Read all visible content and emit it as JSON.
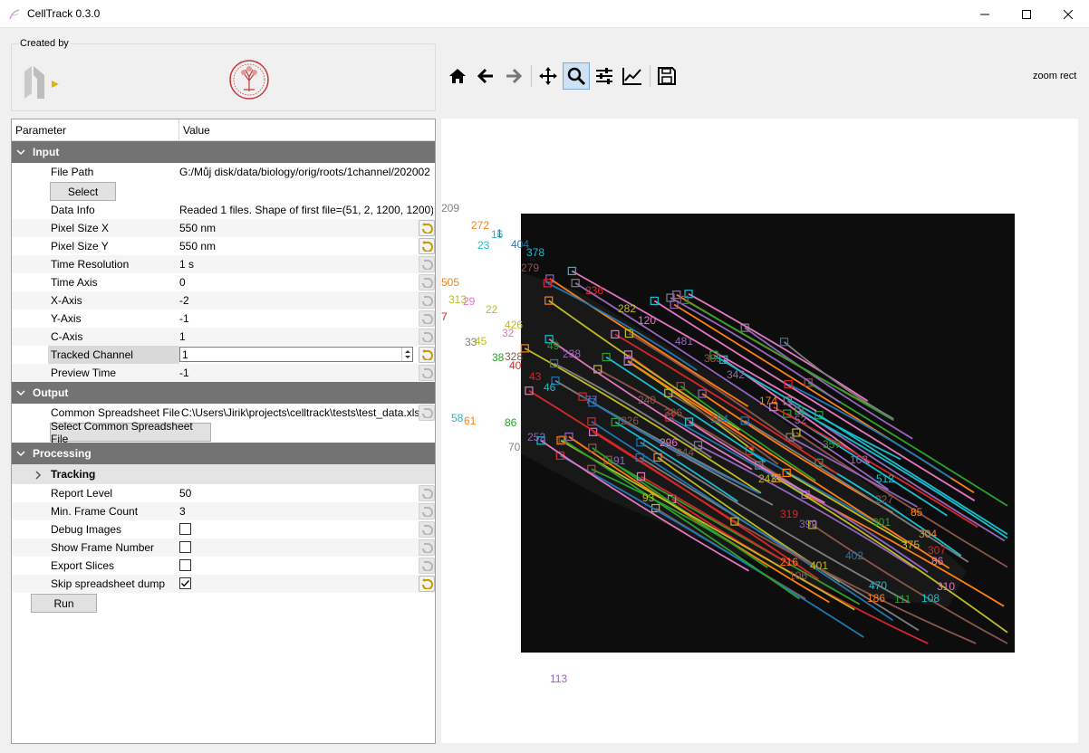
{
  "window": {
    "title": "CellTrack 0.3.0",
    "minimize_icon": "minimize-icon",
    "maximize_icon": "maximize-icon",
    "close_icon": "close-icon"
  },
  "created_by": {
    "label": "Created by"
  },
  "toolbar": {
    "buttons": [
      "home-icon",
      "back-icon",
      "forward-icon",
      "pan-icon",
      "zoom-icon",
      "configure-subplots-icon",
      "edit-axis-icon",
      "save-icon"
    ],
    "active": "zoom-icon",
    "mode_text": "zoom rect"
  },
  "tree": {
    "header": {
      "param": "Parameter",
      "value": "Value"
    },
    "input": {
      "title": "Input",
      "file_path_label": "File Path",
      "file_path_value": "G:/Můj disk/data/biology/orig/roots/1channel/202002",
      "select_button": "Select",
      "data_info_label": "Data Info",
      "data_info_value": "Readed 1 files. Shape of first file=(51, 2, 1200, 1200)",
      "pixel_x_label": "Pixel Size X",
      "pixel_x_value": "550 nm",
      "pixel_y_label": "Pixel Size Y",
      "pixel_y_value": "550 nm",
      "time_res_label": "Time Resolution",
      "time_res_value": "1 s",
      "time_axis_label": "Time Axis",
      "time_axis_value": "0",
      "x_axis_label": "X-Axis",
      "x_axis_value": "-2",
      "y_axis_label": "Y-Axis",
      "y_axis_value": "-1",
      "c_axis_label": "C-Axis",
      "c_axis_value": "1",
      "tracked_channel_label": "Tracked Channel",
      "tracked_channel_value": "1",
      "preview_time_label": "Preview Time",
      "preview_time_value": "-1"
    },
    "output": {
      "title": "Output",
      "spreadsheet_label": "Common Spreadsheet File",
      "spreadsheet_value": "C:\\Users\\Jirik\\projects\\celltrack\\tests\\test_data.xlsx",
      "select_spreadsheet_button": "Select Common Spreadsheet File"
    },
    "processing": {
      "title": "Processing",
      "tracking_label": "Tracking",
      "report_level_label": "Report Level",
      "report_level_value": "50",
      "min_frame_label": "Min. Frame Count",
      "min_frame_value": "3",
      "debug_images_label": "Debug Images",
      "debug_images_checked": false,
      "show_frame_label": "Show Frame Number",
      "show_frame_checked": false,
      "export_slices_label": "Export Slices",
      "export_slices_checked": false,
      "skip_dump_label": "Skip spreadsheet dump",
      "skip_dump_checked": true,
      "run_button": "Run"
    }
  },
  "plot": {
    "outside_labels": [
      {
        "text": "209",
        "color": "#7f7f7f"
      },
      {
        "text": "272",
        "color": "#ff7f0e"
      },
      {
        "text": "1",
        "color": "#1f77b4"
      },
      {
        "text": "16",
        "color": "#17becf"
      },
      {
        "text": "23",
        "color": "#17becf"
      },
      {
        "text": "505",
        "color": "#ff7f0e"
      },
      {
        "text": "313",
        "color": "#bcbd22"
      },
      {
        "text": "29",
        "color": "#e377c2"
      },
      {
        "text": "7",
        "color": "#d62728"
      },
      {
        "text": "22",
        "color": "#bcbd22"
      },
      {
        "text": "33",
        "color": "#7f7f7f"
      },
      {
        "text": "45",
        "color": "#bcbd22"
      },
      {
        "text": "58",
        "color": "#17becf"
      },
      {
        "text": "61",
        "color": "#ff7f0e"
      },
      {
        "text": "113",
        "color": "#9467bd"
      }
    ],
    "track_labels": [
      {
        "text": "404",
        "color": "#1f77b4"
      },
      {
        "text": "378",
        "color": "#17becf"
      },
      {
        "text": "279",
        "color": "#8c564b"
      },
      {
        "text": "236",
        "color": "#d62728"
      },
      {
        "text": "282",
        "color": "#bcbd22"
      },
      {
        "text": "120",
        "color": "#e377c2"
      },
      {
        "text": "481",
        "color": "#9467bd"
      },
      {
        "text": "426",
        "color": "#bcbd22"
      },
      {
        "text": "32",
        "color": "#e377c2"
      },
      {
        "text": "49",
        "color": "#2ca02c"
      },
      {
        "text": "238",
        "color": "#9467bd"
      },
      {
        "text": "38",
        "color": "#2ca02c"
      },
      {
        "text": "328",
        "color": "#8c564b"
      },
      {
        "text": "40",
        "color": "#d62728"
      },
      {
        "text": "385",
        "color": "#8c564b"
      },
      {
        "text": "342",
        "color": "#9467bd"
      },
      {
        "text": "43",
        "color": "#d62728"
      },
      {
        "text": "46",
        "color": "#17becf"
      },
      {
        "text": "77",
        "color": "#9467bd"
      },
      {
        "text": "240",
        "color": "#8c564b"
      },
      {
        "text": "174",
        "color": "#ff7f0e"
      },
      {
        "text": "52",
        "color": "#9467bd"
      },
      {
        "text": "86",
        "color": "#2ca02c"
      },
      {
        "text": "226",
        "color": "#8c564b"
      },
      {
        "text": "386",
        "color": "#8c564b"
      },
      {
        "text": "164",
        "color": "#1f77b4"
      },
      {
        "text": "70",
        "color": "#7f7f7f"
      },
      {
        "text": "252",
        "color": "#9467bd"
      },
      {
        "text": "296",
        "color": "#e377c2"
      },
      {
        "text": "344",
        "color": "#8c564b"
      },
      {
        "text": "357",
        "color": "#2ca02c"
      },
      {
        "text": "163",
        "color": "#9467bd"
      },
      {
        "text": "91",
        "color": "#9467bd"
      },
      {
        "text": "243",
        "color": "#bcbd22"
      },
      {
        "text": "512",
        "color": "#17becf"
      },
      {
        "text": "227",
        "color": "#8c564b"
      },
      {
        "text": "93",
        "color": "#bcbd22"
      },
      {
        "text": "85",
        "color": "#ff7f0e"
      },
      {
        "text": "319",
        "color": "#d62728"
      },
      {
        "text": "399",
        "color": "#9467bd"
      },
      {
        "text": "301",
        "color": "#2ca02c"
      },
      {
        "text": "304",
        "color": "#ff7f0e"
      },
      {
        "text": "375",
        "color": "#bcbd22"
      },
      {
        "text": "307",
        "color": "#d62728"
      },
      {
        "text": "402",
        "color": "#1f77b4"
      },
      {
        "text": "216",
        "color": "#ff7f0e"
      },
      {
        "text": "401",
        "color": "#bcbd22"
      },
      {
        "text": "106",
        "color": "#8c564b"
      },
      {
        "text": "470",
        "color": "#17becf"
      },
      {
        "text": "186",
        "color": "#ff7f0e"
      },
      {
        "text": "111",
        "color": "#2ca02c"
      },
      {
        "text": "108",
        "color": "#17becf"
      },
      {
        "text": "310",
        "color": "#e377c2"
      },
      {
        "text": "86",
        "color": "#e377c2"
      }
    ]
  }
}
